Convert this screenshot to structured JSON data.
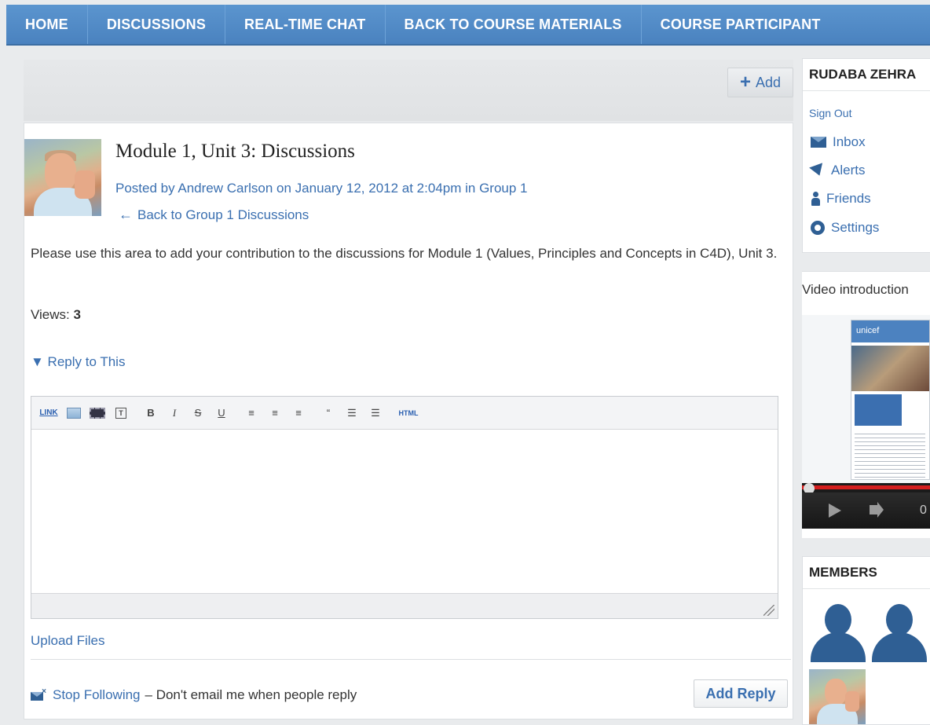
{
  "nav": {
    "items": [
      "HOME",
      "DISCUSSIONS",
      "REAL-TIME CHAT",
      "BACK TO COURSE MATERIALS",
      "COURSE PARTICIPANT"
    ]
  },
  "main": {
    "add_label": "Add",
    "post": {
      "title": "Module 1, Unit 3: Discussions",
      "meta": "Posted by Andrew Carlson on January 12, 2012 at 2:04pm in Group 1",
      "back_link": "Back to Group 1 Discussions",
      "body": "Please use this area to add your contribution to the discussions for Module 1 (Values, Principles and Concepts in C4D), Unit 3.",
      "views_label": "Views:",
      "views_count": "3",
      "reply_toggle": "▼ Reply to This"
    },
    "toolbar": {
      "link": "LINK",
      "bold": "B",
      "italic": "I",
      "strike": "S",
      "underline": "U",
      "quote": "“",
      "html": "HTML"
    },
    "editor_value": "",
    "upload_files": "Upload Files",
    "follow": {
      "link": "Stop Following",
      "text": "– Don't email me when people reply"
    },
    "add_reply": "Add Reply"
  },
  "sidebar": {
    "user_name": "RUDABA ZEHRA",
    "sign_out": "Sign Out",
    "links": {
      "inbox": "Inbox",
      "alerts": "Alerts",
      "friends": "Friends",
      "settings": "Settings"
    },
    "video_title": "Video introduction",
    "video_brand": "unicef",
    "video_time": "0",
    "members_title": "MEMBERS"
  },
  "colors": {
    "nav_bg": "#4f8ac8",
    "link": "#3a6fb0",
    "icon": "#2f5f94"
  },
  "icons": {
    "add": "plus-icon",
    "back": "arrow-left-icon",
    "inbox": "envelope-icon",
    "alerts": "alert-icon",
    "friends": "person-icon",
    "settings": "gear-icon"
  }
}
